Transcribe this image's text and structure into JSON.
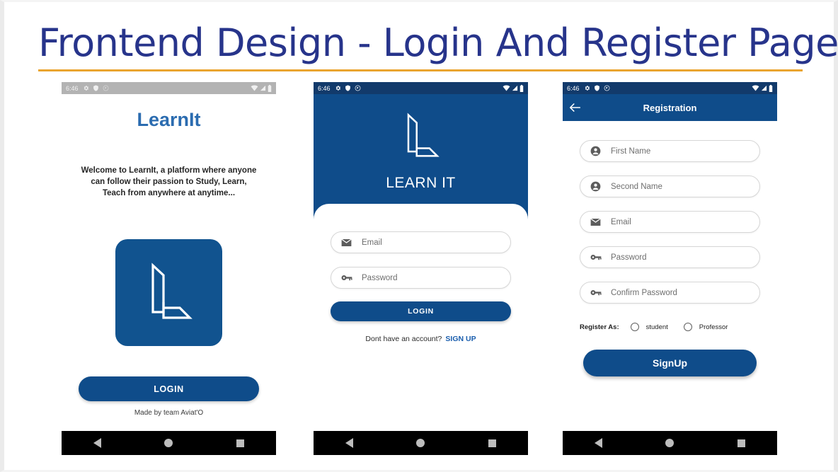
{
  "slide": {
    "title": "Frontend Design - Login And Register Page",
    "title_color": "#27348b",
    "rule_color": "#eaa42f",
    "accent_blue": "#0f4c8a",
    "brand_blue": "#2b6cb0"
  },
  "status_bar": {
    "time": "6:46",
    "left_icons": [
      "gear-icon",
      "shield-icon",
      "sync-disabled-icon"
    ],
    "right_icons": [
      "wifi-icon",
      "signal-icon",
      "battery-icon"
    ]
  },
  "nav_bar": {
    "back": "back-triangle-icon",
    "home": "home-circle-icon",
    "recents": "recents-square-icon"
  },
  "screen1": {
    "brand": "LearnIt",
    "welcome": "Welcome to LearnIt, a platform where anyone can follow their passion to Study, Learn, Teach from anywhere at anytime...",
    "logo": "learnit-l-logo",
    "login_button": "LOGIN",
    "credit": "Made by team Aviat'O"
  },
  "screen2": {
    "logo": "learnit-l-logo",
    "wordmark": "LEARN IT",
    "fields": [
      {
        "label": "Email",
        "icon": "envelope-icon"
      },
      {
        "label": "Password",
        "icon": "key-icon"
      }
    ],
    "login_button": "LOGIN",
    "signup_prompt": "Dont have an account?",
    "signup_link": "SIGN UP"
  },
  "screen3": {
    "back": "arrow-left-icon",
    "title": "Registration",
    "fields": [
      {
        "label": "First Name",
        "icon": "person-icon"
      },
      {
        "label": "Second Name",
        "icon": "person-icon"
      },
      {
        "label": "Email",
        "icon": "envelope-icon"
      },
      {
        "label": "Password",
        "icon": "key-icon"
      },
      {
        "label": "Confirm Password",
        "icon": "key-icon"
      }
    ],
    "register_as_label": "Register As:",
    "roles": [
      "student",
      "Professor"
    ],
    "signup_button": "SignUp"
  }
}
